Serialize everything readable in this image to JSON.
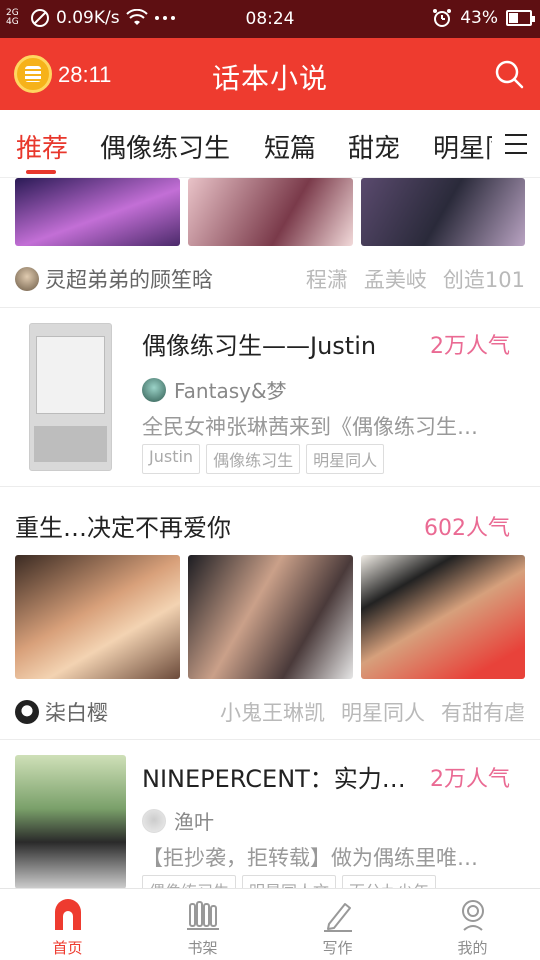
{
  "status_bar": {
    "network": "0.09K/s",
    "signal_label": "2G\n4G",
    "time": "08:24",
    "battery": "43%",
    "battery_level": 0.43,
    "icons": [
      "no-sim-icon",
      "wifi-icon",
      "more-dots-icon",
      "alarm-icon",
      "battery-icon"
    ]
  },
  "header": {
    "timer": "28:11",
    "title": "话本小说",
    "brand_color": "#ee3b2f"
  },
  "tabs": [
    {
      "label": "推荐",
      "active": true
    },
    {
      "label": "偶像练习生"
    },
    {
      "label": "短篇"
    },
    {
      "label": "甜宠"
    },
    {
      "label": "明星同人"
    }
  ],
  "feed": {
    "card1": {
      "author": "灵超弟弟的顾笙晗",
      "tags": [
        "程潇",
        "孟美岐",
        "创造101"
      ]
    },
    "card2": {
      "title": "偶像练习生——Justin",
      "popularity": "2万人气",
      "author": "Fantasy&梦",
      "description": "全民女神张琳茜来到《偶像练习生…",
      "chips": [
        "Justin",
        "偶像练习生",
        "明星同人"
      ]
    },
    "card3": {
      "title": "重生…决定不再爱你",
      "popularity": "602人气",
      "author": "柒白樱",
      "tags": [
        "小鬼王琳凯",
        "明星同人",
        "有甜有虐"
      ]
    },
    "card4": {
      "title": "NINEPERCENT：实力…",
      "popularity": "2万人气",
      "author": "渔叶",
      "description": "【拒抄袭，拒转载】做为偶练里唯…",
      "chips": [
        "偶像练习生",
        "明星同人文",
        "百分九少年"
      ]
    }
  },
  "bottom_nav": [
    {
      "label": "首页",
      "icon": "home-icon",
      "active": true
    },
    {
      "label": "书架",
      "icon": "bookshelf-icon"
    },
    {
      "label": "写作",
      "icon": "pen-icon"
    },
    {
      "label": "我的",
      "icon": "profile-icon"
    }
  ]
}
